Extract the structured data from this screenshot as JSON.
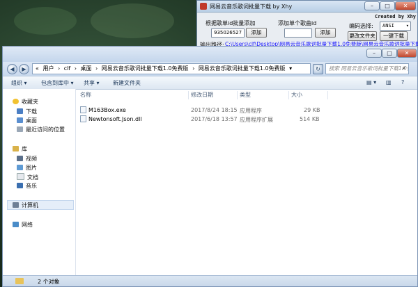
{
  "tool": {
    "title": "网易云音乐歌词批量下载 by Xhy",
    "created_by": "Created by Xhy",
    "album_label": "根据歌单id批量添加",
    "album_value": "935026527",
    "add_album_btn": "添加",
    "song_label": "添加单个歌曲id",
    "song_value": "",
    "add_song_btn": "添加",
    "encoding_label": "编码选择:",
    "encoding_value": "ANSI",
    "change_folder_btn": "更改文件夹",
    "download_btn": "一键下载",
    "output_label": "输出路径:",
    "output_path": "C:\\Users\\clf\\Desktop\\网易云音乐歌词批量下载1.0免费版\\网易云音乐歌词批量下载"
  },
  "explorer": {
    "breadcrumb": [
      "«",
      "用户",
      "›",
      "clf",
      "›",
      "桌面",
      "›",
      "网易云音乐歌词批量下载1.0免费版",
      "›",
      "网易云音乐歌词批量下载1.0免费版",
      "▾"
    ],
    "search_placeholder": "搜索 网易云音乐歌词批量下载1.0免...",
    "commands": {
      "organize": "组织 ▾",
      "include": "包含到库中 ▾",
      "share": "共享 ▾",
      "new_folder": "新建文件夹"
    },
    "columns": {
      "name": "名称",
      "date": "修改日期",
      "type": "类型",
      "size": "大小"
    },
    "sidebar": {
      "favorites": "收藏夹",
      "fav_items": [
        "下载",
        "桌面",
        "最近访问的位置"
      ],
      "library": "库",
      "lib_items": [
        "视频",
        "图片",
        "文档",
        "音乐"
      ],
      "computer": "计算机",
      "network": "网络"
    },
    "files": [
      {
        "name": "M163Box.exe",
        "date": "2017/8/24 18:15",
        "type": "应用程序",
        "size": "29 KB"
      },
      {
        "name": "Newtonsoft.Json.dll",
        "date": "2017/6/18 13:57",
        "type": "应用程序扩展",
        "size": "514 KB"
      }
    ],
    "status": "2 个对象"
  },
  "colors": {
    "link": "#1a1aff",
    "titlebar": "#c4d6ec",
    "desktop": "#1d3322"
  }
}
